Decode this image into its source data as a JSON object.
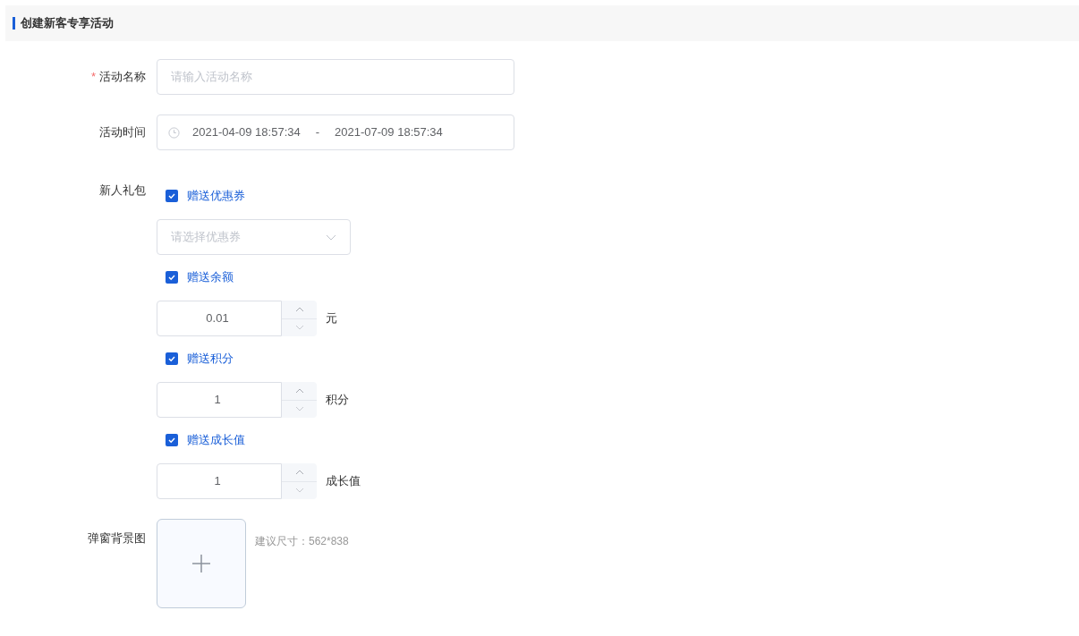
{
  "header": {
    "title": "创建新客专享活动"
  },
  "name_field": {
    "label": "活动名称",
    "required_mark": "*",
    "placeholder": "请输入活动名称"
  },
  "time_field": {
    "label": "活动时间",
    "start": "2021-04-09 18:57:34",
    "separator": "-",
    "end": "2021-07-09 18:57:34"
  },
  "gift_pack": {
    "label": "新人礼包",
    "items": [
      {
        "kind": "select",
        "label": "赠送优惠券",
        "checked": true,
        "placeholder": "请选择优惠券"
      },
      {
        "kind": "number",
        "label": "赠送余额",
        "checked": true,
        "value": "0.01",
        "unit": "元"
      },
      {
        "kind": "number",
        "label": "赠送积分",
        "checked": true,
        "value": "1",
        "unit": "积分"
      },
      {
        "kind": "number",
        "label": "赠送成长值",
        "checked": true,
        "value": "1",
        "unit": "成长值"
      }
    ]
  },
  "background_image": {
    "label": "弹窗背景图",
    "hint": "建议尺寸：562*838"
  }
}
